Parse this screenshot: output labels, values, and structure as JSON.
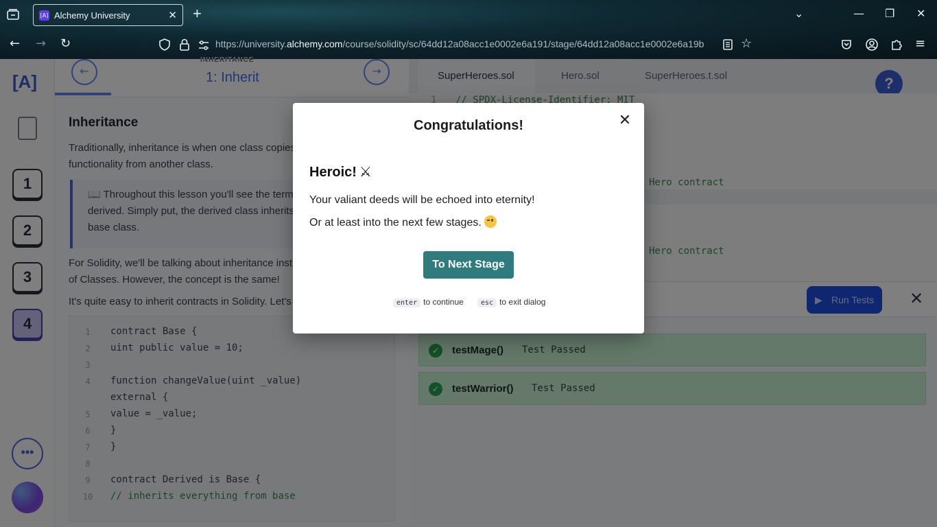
{
  "browser": {
    "tab_title": "Alchemy University",
    "favicon_text": "[A]",
    "url_prefix": "https://university.",
    "url_domain": "alchemy.com",
    "url_path": "/course/solidity/sc/64dd12a08acc1e0002e6a191/stage/64dd12a08acc1e0002e6a19b"
  },
  "lesson": {
    "kicker": "INHERITANCE",
    "title": "1: Inherit",
    "heading": "Inheritance",
    "para1_line1": "Traditionally, inheritance is when one class copies",
    "para1_line2": "functionality from another class.",
    "quote_line1": "📖 Throughout this lesson you'll see the terms base and",
    "quote_line2": "derived. Simply put, the derived class inherits from the",
    "quote_line3": "base class.",
    "para2_line1": "For Solidity, we'll be talking about inheritance instead",
    "para2_line2": "of Classes. However, the concept is the same!",
    "para3": "It's quite easy to inherit contracts in Solidity. Let's",
    "code": [
      {
        "n": "1",
        "t": "contract Base {"
      },
      {
        "n": "2",
        "t": "    uint public value = 10;"
      },
      {
        "n": "3",
        "t": ""
      },
      {
        "n": "4",
        "t": "    function changeValue(uint _value)"
      },
      {
        "n": "",
        "t": "external {"
      },
      {
        "n": "5",
        "t": "        value = _value;"
      },
      {
        "n": "6",
        "t": "    }"
      },
      {
        "n": "7",
        "t": "}"
      },
      {
        "n": "8",
        "t": ""
      },
      {
        "n": "9",
        "t": "contract Derived is Base {"
      },
      {
        "n": "10",
        "t": "    // inherits everything from base"
      }
    ]
  },
  "sidebar": {
    "logo": "[A]",
    "stages": [
      "1",
      "2",
      "3",
      "4"
    ],
    "more_label": "•••"
  },
  "editor": {
    "tabs": [
      "SuperHeroes.sol",
      "Hero.sol",
      "SuperHeroes.t.sol"
    ],
    "line1_num": "1",
    "line1": "// SPDX-License-Identifier: MIT",
    "frag1": "Hero contract",
    "frag2": "Hero contract",
    "help": "?",
    "run_tests": "Run Tests",
    "tests": [
      {
        "name": "testMage()",
        "status": "Test Passed"
      },
      {
        "name": "testWarrior()",
        "status": "Test Passed"
      }
    ]
  },
  "modal": {
    "title": "Congratulations!",
    "heading": "Heroic!",
    "heading_icon": "⚔",
    "line1": "Your valiant deeds will be echoed into eternity!",
    "line2": "Or at least into the next few stages.",
    "button": "To Next Stage",
    "hint_enter_key": "enter",
    "hint_enter_text": "to continue",
    "hint_esc_key": "esc",
    "hint_esc_text": "to exit dialog",
    "close": "✕"
  }
}
